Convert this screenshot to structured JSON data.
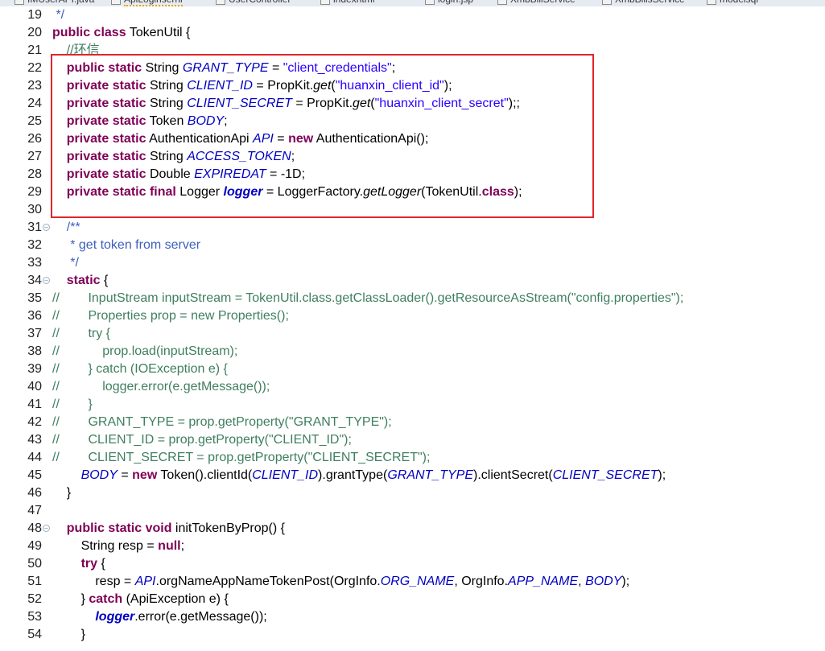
{
  "editor_tabs": [
    "IMUserAPI.java",
    "ApiLoginsernl",
    "UserController",
    "indexhtml",
    "login.jsp",
    "XmbBillService",
    "XmbBillsService",
    "modelsql"
  ],
  "lines": [
    {
      "n": "19",
      "fold": false,
      "segs": [
        [
          "jd",
          " */"
        ]
      ]
    },
    {
      "n": "20",
      "fold": false,
      "segs": [
        [
          "kw",
          "public class"
        ],
        [
          "t",
          " TokenUtil {"
        ]
      ]
    },
    {
      "n": "21",
      "fold": false,
      "segs": [
        [
          "cm",
          "    //环信"
        ]
      ]
    },
    {
      "n": "22",
      "fold": false,
      "segs": [
        [
          "kw",
          "    public static"
        ],
        [
          "t",
          " String "
        ],
        [
          "fld",
          "GRANT_TYPE"
        ],
        [
          "t",
          " = "
        ],
        [
          "str",
          "\"client_credentials\""
        ],
        [
          "t",
          ";"
        ]
      ]
    },
    {
      "n": "23",
      "fold": false,
      "segs": [
        [
          "kw",
          "    private static"
        ],
        [
          "t",
          " String "
        ],
        [
          "fld",
          "CLIENT_ID"
        ],
        [
          "t",
          " = PropKit."
        ],
        [
          "it",
          "get"
        ],
        [
          "t",
          "("
        ],
        [
          "str",
          "\"huanxin_client_id\""
        ],
        [
          "t",
          ");"
        ]
      ]
    },
    {
      "n": "24",
      "fold": false,
      "segs": [
        [
          "kw",
          "    private static"
        ],
        [
          "t",
          " String "
        ],
        [
          "fld",
          "CLIENT_SECRET"
        ],
        [
          "t",
          " = PropKit."
        ],
        [
          "it",
          "get"
        ],
        [
          "t",
          "("
        ],
        [
          "str",
          "\"huanxin_client_secret\""
        ],
        [
          "t",
          ");;"
        ]
      ]
    },
    {
      "n": "25",
      "fold": false,
      "segs": [
        [
          "kw",
          "    private static"
        ],
        [
          "t",
          " Token "
        ],
        [
          "fld",
          "BODY"
        ],
        [
          "t",
          ";"
        ]
      ]
    },
    {
      "n": "26",
      "fold": false,
      "segs": [
        [
          "kw",
          "    private static"
        ],
        [
          "t",
          " AuthenticationApi "
        ],
        [
          "fld",
          "API"
        ],
        [
          "t",
          " = "
        ],
        [
          "kw",
          "new"
        ],
        [
          "t",
          " AuthenticationApi();"
        ]
      ]
    },
    {
      "n": "27",
      "fold": false,
      "segs": [
        [
          "kw",
          "    private static"
        ],
        [
          "t",
          " String "
        ],
        [
          "fld",
          "ACCESS_TOKEN"
        ],
        [
          "t",
          ";"
        ]
      ]
    },
    {
      "n": "28",
      "fold": false,
      "segs": [
        [
          "kw",
          "    private static"
        ],
        [
          "t",
          " Double "
        ],
        [
          "fld",
          "EXPIREDAT"
        ],
        [
          "t",
          " = -1D;"
        ]
      ]
    },
    {
      "n": "29",
      "fold": false,
      "segs": [
        [
          "kw",
          "    private static final"
        ],
        [
          "t",
          " Logger "
        ],
        [
          "fldb",
          "logger"
        ],
        [
          "t",
          " = LoggerFactory."
        ],
        [
          "it",
          "getLogger"
        ],
        [
          "t",
          "(TokenUtil."
        ],
        [
          "kw",
          "class"
        ],
        [
          "t",
          ");"
        ]
      ]
    },
    {
      "n": "30",
      "fold": false,
      "segs": []
    },
    {
      "n": "31",
      "fold": true,
      "segs": [
        [
          "jd",
          "    /**"
        ]
      ]
    },
    {
      "n": "32",
      "fold": false,
      "segs": [
        [
          "jd",
          "     * get token from server"
        ]
      ]
    },
    {
      "n": "33",
      "fold": false,
      "segs": [
        [
          "jd",
          "     */"
        ]
      ]
    },
    {
      "n": "34",
      "fold": true,
      "segs": [
        [
          "kw",
          "    static"
        ],
        [
          "t",
          " {"
        ]
      ]
    },
    {
      "n": "35",
      "fold": false,
      "segs": [
        [
          "cm",
          "//        InputStream inputStream = TokenUtil.class.getClassLoader().getResourceAsStream(\"config.properties\");"
        ]
      ]
    },
    {
      "n": "36",
      "fold": false,
      "segs": [
        [
          "cm",
          "//        Properties prop = new Properties();"
        ]
      ]
    },
    {
      "n": "37",
      "fold": false,
      "segs": [
        [
          "cm",
          "//        try {"
        ]
      ]
    },
    {
      "n": "38",
      "fold": false,
      "segs": [
        [
          "cm",
          "//            prop.load(inputStream);"
        ]
      ]
    },
    {
      "n": "39",
      "fold": false,
      "segs": [
        [
          "cm",
          "//        } catch (IOException e) {"
        ]
      ]
    },
    {
      "n": "40",
      "fold": false,
      "segs": [
        [
          "cm",
          "//            logger.error(e.getMessage());"
        ]
      ]
    },
    {
      "n": "41",
      "fold": false,
      "segs": [
        [
          "cm",
          "//        }"
        ]
      ]
    },
    {
      "n": "42",
      "fold": false,
      "segs": [
        [
          "cm",
          "//        GRANT_TYPE = prop.getProperty(\"GRANT_TYPE\");"
        ]
      ]
    },
    {
      "n": "43",
      "fold": false,
      "segs": [
        [
          "cm",
          "//        CLIENT_ID = prop.getProperty(\"CLIENT_ID\");"
        ]
      ]
    },
    {
      "n": "44",
      "fold": false,
      "segs": [
        [
          "cm",
          "//        CLIENT_SECRET = prop.getProperty(\"CLIENT_SECRET\");"
        ]
      ]
    },
    {
      "n": "45",
      "fold": false,
      "segs": [
        [
          "t",
          "        "
        ],
        [
          "fld",
          "BODY"
        ],
        [
          "t",
          " = "
        ],
        [
          "kw",
          "new"
        ],
        [
          "t",
          " Token().clientId("
        ],
        [
          "fld",
          "CLIENT_ID"
        ],
        [
          "t",
          ").grantType("
        ],
        [
          "fld",
          "GRANT_TYPE"
        ],
        [
          "t",
          ").clientSecret("
        ],
        [
          "fld",
          "CLIENT_SECRET"
        ],
        [
          "t",
          ");"
        ]
      ]
    },
    {
      "n": "46",
      "fold": false,
      "segs": [
        [
          "t",
          "    }"
        ]
      ]
    },
    {
      "n": "47",
      "fold": false,
      "segs": []
    },
    {
      "n": "48",
      "fold": true,
      "segs": [
        [
          "kw",
          "    public static void"
        ],
        [
          "t",
          " initTokenByProp() {"
        ]
      ]
    },
    {
      "n": "49",
      "fold": false,
      "segs": [
        [
          "t",
          "        String resp = "
        ],
        [
          "kw",
          "null"
        ],
        [
          "t",
          ";"
        ]
      ]
    },
    {
      "n": "50",
      "fold": false,
      "segs": [
        [
          "kw",
          "        try"
        ],
        [
          "t",
          " {"
        ]
      ]
    },
    {
      "n": "51",
      "fold": false,
      "segs": [
        [
          "t",
          "            resp = "
        ],
        [
          "fld",
          "API"
        ],
        [
          "t",
          ".orgNameAppNameTokenPost(OrgInfo."
        ],
        [
          "fld",
          "ORG_NAME"
        ],
        [
          "t",
          ", OrgInfo."
        ],
        [
          "fld",
          "APP_NAME"
        ],
        [
          "t",
          ", "
        ],
        [
          "fld",
          "BODY"
        ],
        [
          "t",
          ");"
        ]
      ]
    },
    {
      "n": "52",
      "fold": false,
      "segs": [
        [
          "t",
          "        } "
        ],
        [
          "kw",
          "catch"
        ],
        [
          "t",
          " (ApiException e) {"
        ]
      ]
    },
    {
      "n": "53",
      "fold": false,
      "segs": [
        [
          "t",
          "            "
        ],
        [
          "fldb",
          "logger"
        ],
        [
          "t",
          ".error(e.getMessage());"
        ]
      ]
    },
    {
      "n": "54",
      "fold": false,
      "segs": [
        [
          "t",
          "        }"
        ]
      ]
    }
  ],
  "colors": {
    "highlight_box": "#e0252b",
    "keyword": "#7f0055",
    "field": "#0000c0",
    "string": "#2a00ff",
    "comment": "#3f7f5f",
    "javadoc": "#3f5fbf"
  }
}
